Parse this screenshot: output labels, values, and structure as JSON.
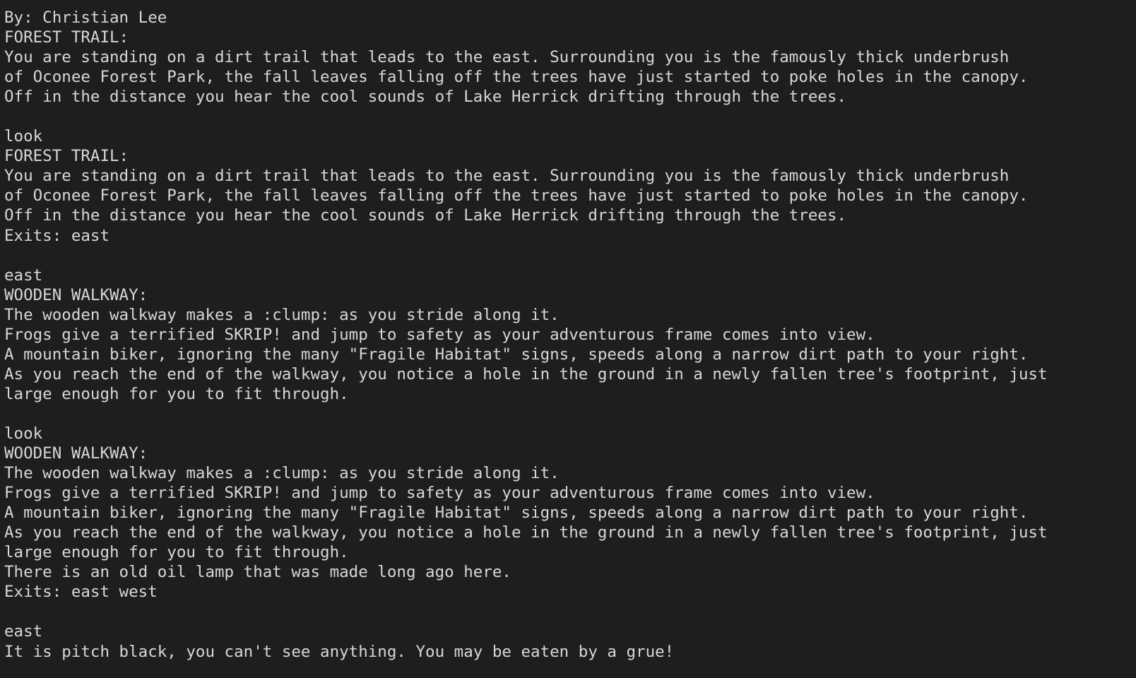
{
  "terminal": {
    "lines": [
      "By: Christian Lee",
      "FOREST TRAIL:",
      "You are standing on a dirt trail that leads to the east. Surrounding you is the famously thick underbrush",
      "of Oconee Forest Park, the fall leaves falling off the trees have just started to poke holes in the canopy.",
      "Off in the distance you hear the cool sounds of Lake Herrick drifting through the trees.",
      "",
      "look",
      "FOREST TRAIL:",
      "You are standing on a dirt trail that leads to the east. Surrounding you is the famously thick underbrush",
      "of Oconee Forest Park, the fall leaves falling off the trees have just started to poke holes in the canopy.",
      "Off in the distance you hear the cool sounds of Lake Herrick drifting through the trees.",
      "Exits: east",
      "",
      "east",
      "WOODEN WALKWAY:",
      "The wooden walkway makes a :clump: as you stride along it.",
      "Frogs give a terrified SKRIP! and jump to safety as your adventurous frame comes into view.",
      "A mountain biker, ignoring the many \"Fragile Habitat\" signs, speeds along a narrow dirt path to your right.",
      "As you reach the end of the walkway, you notice a hole in the ground in a newly fallen tree's footprint, just",
      "large enough for you to fit through.",
      "",
      "look",
      "WOODEN WALKWAY:",
      "The wooden walkway makes a :clump: as you stride along it.",
      "Frogs give a terrified SKRIP! and jump to safety as your adventurous frame comes into view.",
      "A mountain biker, ignoring the many \"Fragile Habitat\" signs, speeds along a narrow dirt path to your right.",
      "As you reach the end of the walkway, you notice a hole in the ground in a newly fallen tree's footprint, just",
      "large enough for you to fit through.",
      "There is an old oil lamp that was made long ago here.",
      "Exits: east west",
      "",
      "east",
      "It is pitch black, you can't see anything. You may be eaten by a grue!"
    ]
  }
}
